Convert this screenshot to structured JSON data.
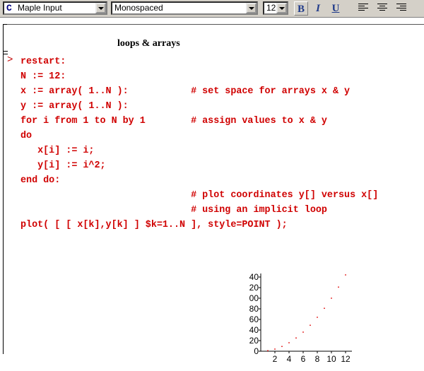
{
  "toolbar": {
    "mode_icon": "C",
    "mode_value": "Maple Input",
    "font_value": "Monospaced",
    "size_value": "12",
    "bold_label": "B",
    "italic_label": "I",
    "underline_label": "U",
    "align_left_icon": "align-left-icon",
    "align_center_icon": "align-center-icon",
    "align_right_icon": "align-right-icon"
  },
  "document": {
    "title": "loops & arrays",
    "prompt": ">",
    "lines": [
      "restart:",
      "N := 12:",
      "x := array( 1..N ):           # set space for arrays x & y",
      "y := array( 1..N ):",
      "for i from 1 to N by 1        # assign values to x & y",
      "do",
      "   x[i] := i;",
      "   y[i] := i^2;",
      "end do:",
      "                              # plot coordinates y[] versus x[]",
      "                              # using an implicit loop",
      "plot( [ [ x[k],y[k] ] $k=1..N ], style=POINT );"
    ]
  },
  "colors": {
    "code": "#d00000",
    "points": "#e00000",
    "toolbar_bg": "#d4d0c8"
  },
  "chart_data": {
    "type": "scatter",
    "title": "",
    "xlabel": "",
    "ylabel": "",
    "x": [
      1,
      2,
      3,
      4,
      5,
      6,
      7,
      8,
      9,
      10,
      11,
      12
    ],
    "y": [
      1,
      4,
      9,
      16,
      25,
      36,
      49,
      64,
      81,
      100,
      121,
      144
    ],
    "xlim": [
      0,
      12.5
    ],
    "ylim": [
      0,
      144
    ],
    "x_ticks": [
      "2",
      "4",
      "6",
      "8",
      "10",
      "12"
    ],
    "y_ticks": [
      "0",
      "20",
      "40",
      "60",
      "80",
      "00",
      "20",
      "40"
    ],
    "grid": false,
    "legend": "none"
  }
}
